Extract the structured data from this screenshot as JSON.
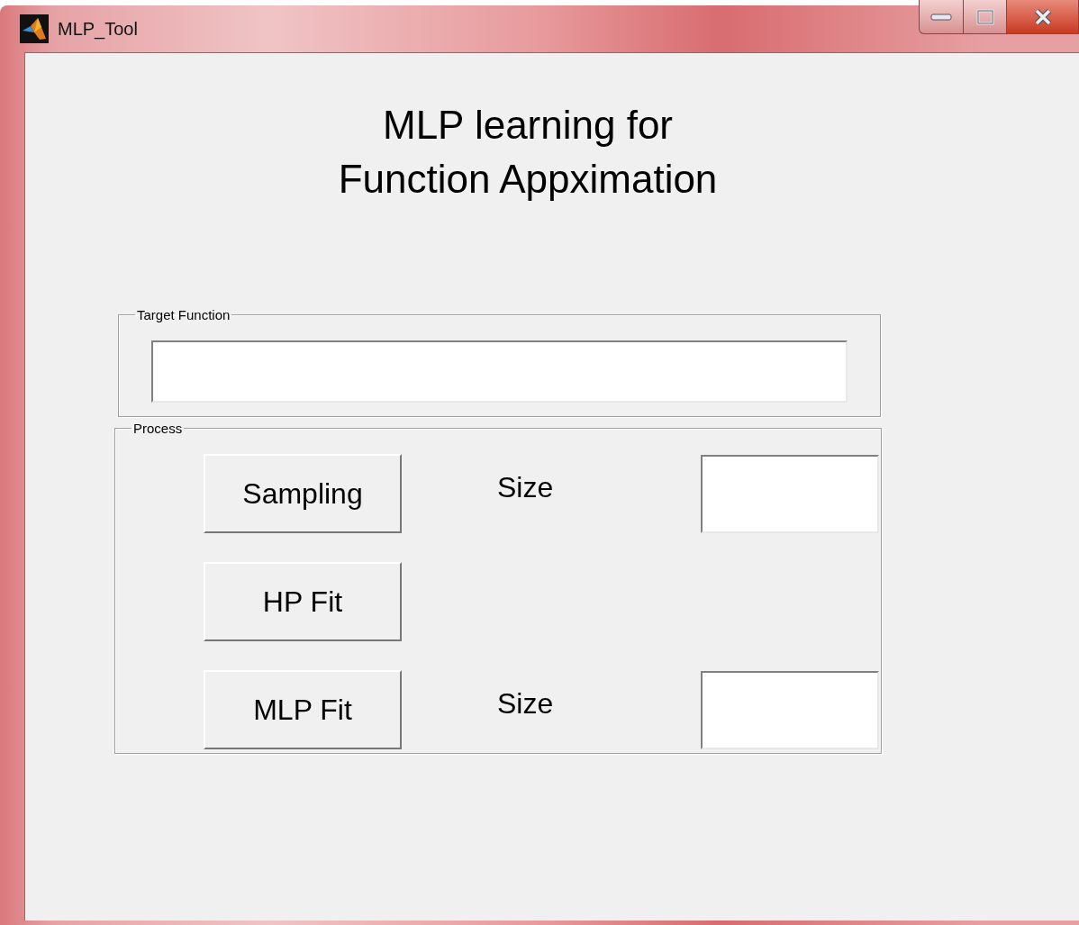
{
  "window": {
    "title": "MLP_Tool"
  },
  "heading_lines": [
    "MLP learning for",
    "Function Appximation"
  ],
  "target_panel": {
    "label": "Target Function"
  },
  "process_panel": {
    "label": "Process",
    "rows": [
      {
        "button": "Sampling",
        "size_label": "Size"
      },
      {
        "button": "HP Fit"
      },
      {
        "button": "MLP Fit",
        "size_label": "Size"
      }
    ]
  }
}
